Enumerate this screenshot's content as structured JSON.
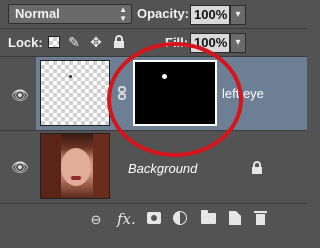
{
  "toolbar": {
    "blend_mode": "Normal",
    "opacity_label": "Opacity:",
    "opacity_value": "100%",
    "lock_label": "Lock:",
    "fill_label": "Fill:",
    "fill_value": "100%"
  },
  "layers": [
    {
      "name": "left eye",
      "selected": true,
      "has_mask": true
    },
    {
      "name": "Background",
      "selected": false,
      "locked": true
    }
  ],
  "footer_icons": [
    "link-icon",
    "fx-icon",
    "add-mask-icon",
    "adjustment-icon",
    "folder-icon",
    "new-layer-icon",
    "trash-icon"
  ],
  "colors": {
    "panel": "#535353",
    "selected_layer": "#6c7f95",
    "highlight_circle": "#d5141b"
  }
}
